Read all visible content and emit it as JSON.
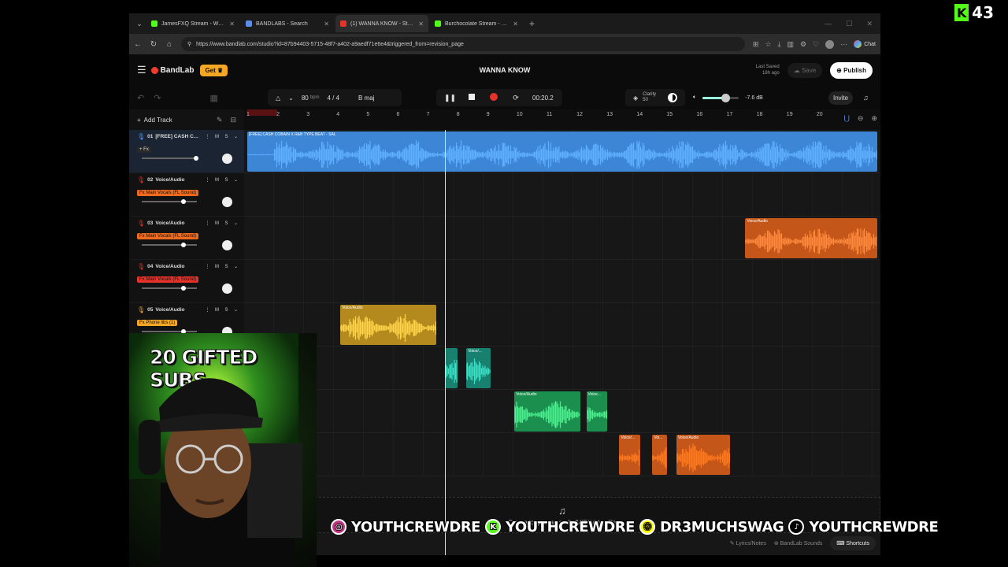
{
  "stream": {
    "kick_viewers": "43",
    "kick_logo": "K",
    "gift_banner": "20 GIFTED SUBS",
    "socials": [
      {
        "platform": "instagram",
        "icon": "instagram-icon",
        "handle": "YOUTHCREWDRE",
        "color": "#c13584"
      },
      {
        "platform": "kick",
        "icon": "kick-icon",
        "handle": "YOUTHCREWDRE",
        "color": "#53fc18"
      },
      {
        "platform": "snapchat",
        "icon": "snapchat-icon",
        "handle": "DR3MUCHSWAG",
        "color": "#fffc00"
      },
      {
        "platform": "tiktok",
        "icon": "tiktok-icon",
        "handle": "YOUTHCREWDRE",
        "color": "#000000"
      }
    ]
  },
  "browser": {
    "tabs": [
      {
        "title": "JamesFXQ Stream - Watch Live on",
        "favicon_color": "#53fc18",
        "active": false
      },
      {
        "title": "BANDLABS - Search",
        "favicon_color": "#5b8def",
        "active": false
      },
      {
        "title": "(1) WANNA KNOW - Studio",
        "favicon_color": "#e5332a",
        "active": true
      },
      {
        "title": "Burchocolate Stream - Watch Live",
        "favicon_color": "#53fc18",
        "active": false
      }
    ],
    "url": "https://www.bandlab.com/studio?id=87b94403-5715-48f7-a402-a9aedf71e6e4&triggered_from=revision_page",
    "chat_label": "Chat"
  },
  "app": {
    "brand": "BandLab",
    "get_label": "Get",
    "project_title": "WANNA KNOW",
    "last_saved_label": "Last Saved",
    "last_saved_time": "18h ago",
    "save_label": "Save",
    "publish_label": "Publish",
    "invite_label": "Invite",
    "bpm": "80",
    "bpm_unit": "bpm",
    "time_signature": "4 / 4",
    "key": "B maj",
    "time_display": "00:20.2",
    "clarity_label": "Clarity",
    "clarity_value": "50",
    "volume_db": "-7.6 dB",
    "volume_level": 0.62,
    "add_track_label": "Add Track",
    "drop_text": "Drop a loop or an audio/MIDI/video file",
    "lyrics_label": "Lyrics/Notes",
    "sounds_label": "BandLab Sounds",
    "shortcuts_label": "Shortcuts",
    "ruler": [
      "1",
      "2",
      "3",
      "4",
      "5",
      "6",
      "7",
      "8",
      "9",
      "10",
      "11",
      "12",
      "13",
      "14",
      "15",
      "16",
      "17",
      "18",
      "19",
      "20"
    ],
    "playhead_bar": 7.6
  },
  "tracks": [
    {
      "num": "01",
      "name": "[FREE] CASH COBA...",
      "fx": "+ Fx",
      "fx_color": "#2a2a2a",
      "fx_text_color": "#ddd",
      "mic_color": "#4a9bff",
      "volume": 1.0
    },
    {
      "num": "02",
      "name": "Voice/Audio",
      "fx": "Fx Main Vocals (FL Sound)",
      "fx_color": "#f06a1d",
      "fx_text_color": "#111",
      "mic_color": "#e5332a",
      "volume": 0.75
    },
    {
      "num": "03",
      "name": "Voice/Audio",
      "fx": "Fx Main Vocals (FL Sound)",
      "fx_color": "#f06a1d",
      "fx_text_color": "#111",
      "mic_color": "#e5332a",
      "volume": 0.75
    },
    {
      "num": "04",
      "name": "Voice/Audio",
      "fx": "Fx Main Vocals (FL Sound)",
      "fx_color": "#e5332a",
      "fx_text_color": "#111",
      "mic_color": "#e5332a",
      "volume": 0.75
    },
    {
      "num": "05",
      "name": "Voice/Audio",
      "fx": "Fx Phone libs (1)",
      "fx_color": "#f5a623",
      "fx_text_color": "#111",
      "mic_color": "#f5a623",
      "volume": 0.75
    }
  ],
  "clips": [
    {
      "lane": 0,
      "start": 1.0,
      "end": 22,
      "title": "[FREE] CASH COBAIN X R&B TYPE BEAT - SAL",
      "color": "#3d86d6",
      "wave": "#5fb0ff",
      "silent_until": 1.9
    },
    {
      "lane": 2,
      "start": 17.6,
      "end": 22,
      "title": "Voice/Audio",
      "color": "#c4561a",
      "wave": "#ff8a3d"
    },
    {
      "lane": 4,
      "start": 4.1,
      "end": 7.3,
      "title": "Voice/Audio",
      "color": "#b48a1f",
      "wave": "#ffd34a"
    },
    {
      "lane": 5,
      "start": 7.6,
      "end": 8.0,
      "title": "",
      "color": "#17806f",
      "wave": "#3be0c6"
    },
    {
      "lane": 5,
      "start": 8.3,
      "end": 9.1,
      "title": "Voice/...",
      "color": "#17806f",
      "wave": "#3be0c6"
    },
    {
      "lane": 6,
      "start": 9.9,
      "end": 12.1,
      "title": "Voice/Audio",
      "color": "#1b8f4e",
      "wave": "#4bf08f"
    },
    {
      "lane": 6,
      "start": 12.3,
      "end": 13.0,
      "title": "Voice...",
      "color": "#1b8f4e",
      "wave": "#4bf08f"
    },
    {
      "lane": 7,
      "start": 13.4,
      "end": 14.1,
      "title": "Voice/...",
      "color": "#c4561a",
      "wave": "#ff7a1d"
    },
    {
      "lane": 7,
      "start": 14.5,
      "end": 15.0,
      "title": "Voi...",
      "color": "#c4561a",
      "wave": "#ff7a1d"
    },
    {
      "lane": 7,
      "start": 15.3,
      "end": 17.1,
      "title": "Voice/Audio",
      "color": "#c4561a",
      "wave": "#ff7a1d"
    }
  ]
}
